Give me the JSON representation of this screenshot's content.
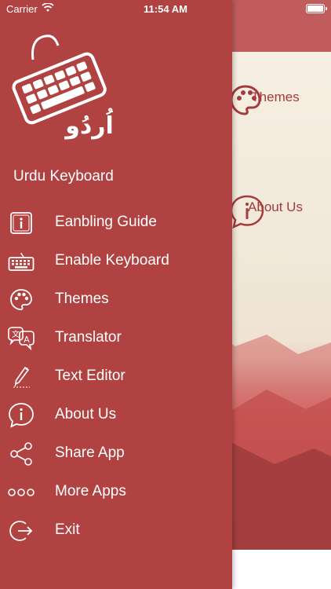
{
  "status_bar": {
    "carrier": "Carrier",
    "time": "11:54 AM"
  },
  "drawer": {
    "logo_text": "اُردُو",
    "app_name": "Urdu Keyboard",
    "items": [
      {
        "label": "Eanbling Guide",
        "icon": "info-square-icon"
      },
      {
        "label": "Enable Keyboard",
        "icon": "keyboard-icon"
      },
      {
        "label": "Themes",
        "icon": "palette-icon"
      },
      {
        "label": "Translator",
        "icon": "translate-icon"
      },
      {
        "label": "Text Editor",
        "icon": "pen-icon"
      },
      {
        "label": "About Us",
        "icon": "info-bubble-icon"
      },
      {
        "label": "Share App",
        "icon": "share-icon"
      },
      {
        "label": "More Apps",
        "icon": "more-dots-icon"
      },
      {
        "label": "Exit",
        "icon": "exit-icon"
      }
    ]
  },
  "main": {
    "tiles": [
      {
        "label": "Themes",
        "icon": "palette-icon"
      },
      {
        "label": "About Us",
        "icon": "info-bubble-icon"
      }
    ]
  },
  "colors": {
    "drawer_bg": "#b04242",
    "accent": "#a43b3c",
    "topbar": "#c05d5c"
  }
}
